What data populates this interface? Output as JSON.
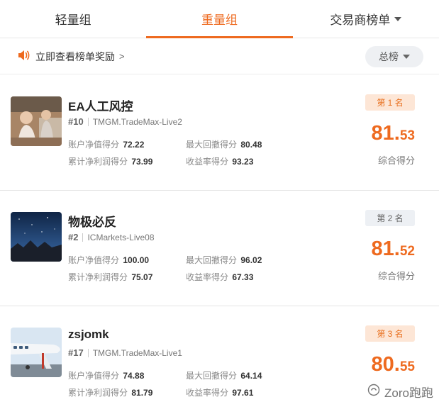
{
  "tabs": [
    {
      "label": "轻量组",
      "active": false
    },
    {
      "label": "重量组",
      "active": true
    },
    {
      "label": "交易商榜单",
      "active": false,
      "has_dropdown": true
    }
  ],
  "notice": {
    "icon": "speaker-icon",
    "text": "立即查看榜单奖励",
    "arrow": ">"
  },
  "rank_select": {
    "label": "总榜"
  },
  "stat_labels": {
    "account_equity": "账户净值得分",
    "max_drawdown": "最大回撤得分",
    "cumulative_profit": "累计净利润得分",
    "return_rate": "收益率得分"
  },
  "score_label": "综合得分",
  "entries": [
    {
      "name": "EA人工风控",
      "rank_no": "#10",
      "server": "TMGM.TradeMax-Live2",
      "account_equity": "72.22",
      "max_drawdown": "80.48",
      "cumulative_profit": "73.99",
      "return_rate": "93.23",
      "badge": "第 1 名",
      "score_int": "81.",
      "score_dec": "53"
    },
    {
      "name": "物极必反",
      "rank_no": "#2",
      "server": "ICMarkets-Live08",
      "account_equity": "100.00",
      "max_drawdown": "96.02",
      "cumulative_profit": "75.07",
      "return_rate": "67.33",
      "badge": "第 2 名",
      "score_int": "81.",
      "score_dec": "52"
    },
    {
      "name": "zsjomk",
      "rank_no": "#17",
      "server": "TMGM.TradeMax-Live1",
      "account_equity": "74.88",
      "max_drawdown": "64.14",
      "cumulative_profit": "81.79",
      "return_rate": "97.61",
      "badge": "第 3 名",
      "score_int": "80.",
      "score_dec": "55"
    }
  ],
  "watermark": {
    "text": "Zoro跑跑"
  },
  "colors": {
    "accent": "#ee6a1f",
    "badge_first_bg": "#fde6d6",
    "badge_other_bg": "#edf0f4"
  }
}
